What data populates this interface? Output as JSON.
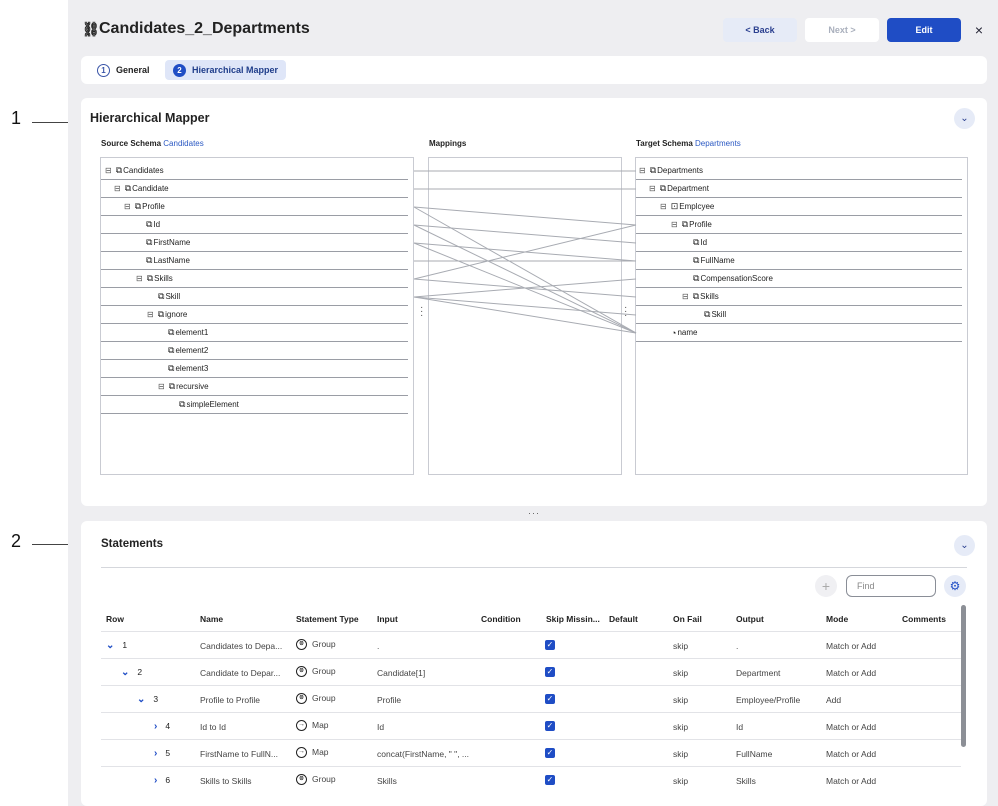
{
  "header": {
    "title": "Candidates_2_Departments",
    "back_label": "< Back",
    "next_label": "Next >",
    "edit_label": "Edit",
    "close_label": "×"
  },
  "tabs": [
    {
      "num": "1",
      "label": "General"
    },
    {
      "num": "2",
      "label": "Hierarchical Mapper"
    }
  ],
  "callouts": {
    "one": "1",
    "two": "2"
  },
  "mapper": {
    "title": "Hierarchical Mapper",
    "source_label": "Source Schema",
    "source_link": "Candidates",
    "mappings_label": "Mappings",
    "target_label": "Target Schema",
    "target_link": "Departments",
    "source_nodes": [
      {
        "label": "Candidates",
        "expander": "⊟"
      },
      {
        "label": "Candidate",
        "expander": "⊟"
      },
      {
        "label": "Profile",
        "expander": "⊟"
      },
      {
        "label": "Id",
        "expander": ""
      },
      {
        "label": "FirstName",
        "expander": ""
      },
      {
        "label": "LastName",
        "expander": ""
      },
      {
        "label": "Skills",
        "expander": "⊟"
      },
      {
        "label": "Skill",
        "expander": ""
      },
      {
        "label": "ignore",
        "expander": "⊟"
      },
      {
        "label": "element1",
        "expander": ""
      },
      {
        "label": "element2",
        "expander": ""
      },
      {
        "label": "element3",
        "expander": ""
      },
      {
        "label": "recursive",
        "expander": "⊟"
      },
      {
        "label": "simpleElement",
        "expander": ""
      }
    ],
    "target_nodes": [
      {
        "label": "Departments",
        "expander": "⊟"
      },
      {
        "label": "Department",
        "expander": "⊟"
      },
      {
        "label": "Emplcyee",
        "expander": "⊟"
      },
      {
        "label": "Profile",
        "expander": "⊟"
      },
      {
        "label": "Id",
        "expander": ""
      },
      {
        "label": "FullName",
        "expander": ""
      },
      {
        "label": "CompensationScore",
        "expander": ""
      },
      {
        "label": "Skills",
        "expander": "⊟"
      },
      {
        "label": "Skill",
        "expander": ""
      },
      {
        "label": "name",
        "expander": ""
      }
    ]
  },
  "statements": {
    "title": "Statements",
    "find_placeholder": "Find",
    "columns": [
      "Row",
      "Name",
      "Statement Type",
      "Input",
      "Condition",
      "Skip Missin...",
      "Default",
      "On Fail",
      "Output",
      "Mode",
      "Comments"
    ],
    "rows": [
      {
        "row": "1",
        "name": "Candidates to Depa...",
        "type": "Group",
        "input": ".",
        "skip_missing": true,
        "on_fail": "skip",
        "output": ".",
        "mode": "Match or Add"
      },
      {
        "row": "2",
        "name": "Candidate to Depar...",
        "type": "Group",
        "input": "Candidate[1]",
        "skip_missing": true,
        "on_fail": "skip",
        "output": "Department",
        "mode": "Match or Add"
      },
      {
        "row": "3",
        "name": "Profile to Profile",
        "type": "Group",
        "input": "Profile",
        "skip_missing": true,
        "on_fail": "skip",
        "output": "Employee/Profile",
        "mode": "Add"
      },
      {
        "row": "4",
        "name": "Id to Id",
        "type": "Map",
        "input": "Id",
        "skip_missing": true,
        "on_fail": "skip",
        "output": "Id",
        "mode": "Match or Add"
      },
      {
        "row": "5",
        "name": "FirstName to FullN...",
        "type": "Map",
        "input": "concat(FirstName, \" \", ...",
        "skip_missing": true,
        "on_fail": "skip",
        "output": "FullName",
        "mode": "Match or Add"
      },
      {
        "row": "6",
        "name": "Skills to Skills",
        "type": "Group",
        "input": "Skills",
        "skip_missing": true,
        "on_fail": "skip",
        "output": "Skills",
        "mode": "Match or Add"
      }
    ]
  }
}
